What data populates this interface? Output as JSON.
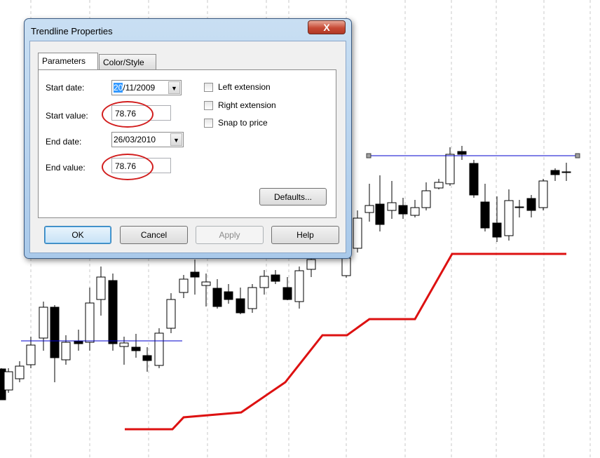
{
  "window": {
    "title": "Trendline Properties",
    "close_label": "X"
  },
  "tabs": [
    {
      "label": "Parameters",
      "active": true
    },
    {
      "label": "Color/Style",
      "active": false
    }
  ],
  "params": {
    "start_date_label": "Start date:",
    "start_date_selected": "20",
    "start_date_rest": "/11/2009",
    "start_value_label": "Start value:",
    "start_value": "78.76",
    "end_date_label": "End date:",
    "end_date": "26/03/2010",
    "end_value_label": "End value:",
    "end_value": "78.76"
  },
  "checkboxes": [
    {
      "label": "Left extension",
      "checked": false
    },
    {
      "label": "Right extension",
      "checked": false
    },
    {
      "label": "Snap to price",
      "checked": false
    }
  ],
  "buttons": {
    "defaults": "Defaults...",
    "ok": "OK",
    "cancel": "Cancel",
    "apply": "Apply",
    "help": "Help"
  },
  "colors": {
    "up_candle": "#ffffff",
    "down_candle": "#000000",
    "trendline": "#0000cc",
    "stop_line": "#dd1111",
    "grid": "#c8c8c8",
    "highlight_oval": "#d21e1e"
  },
  "chart_data": {
    "type": "candlestick",
    "candles": [
      {
        "o": 0,
        "h": 0,
        "l": 0,
        "c": 0
      }
    ],
    "trendlines": [
      {
        "start_date": "20/11/2009",
        "start_value": 78.76,
        "end_date": "26/03/2010",
        "end_value": 78.76
      }
    ]
  }
}
